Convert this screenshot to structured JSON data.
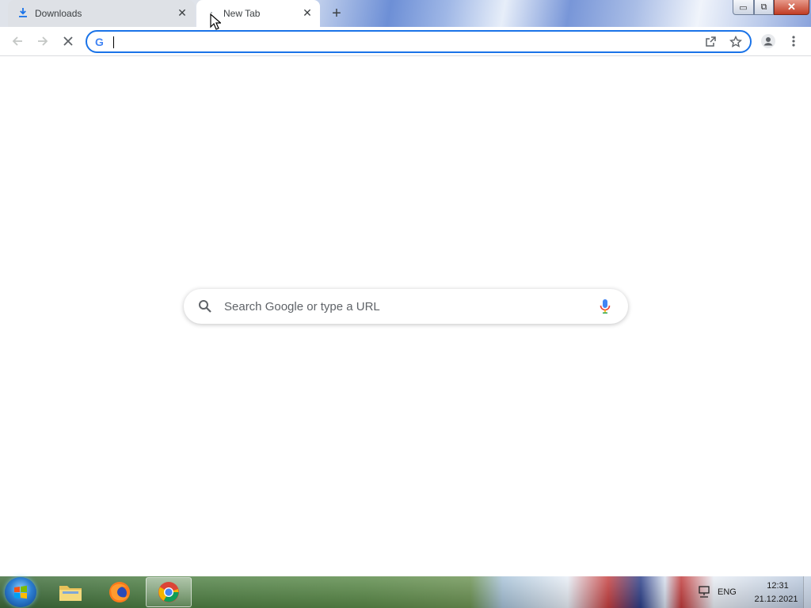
{
  "browser": {
    "tabs": [
      {
        "title": "Downloads",
        "icon": "download-icon",
        "active": false
      },
      {
        "title": "New Tab",
        "icon": "loading-icon",
        "active": true
      }
    ],
    "new_tab_symbol": "+",
    "close_symbol": "✕",
    "window_controls": {
      "minimize": "▭",
      "maximize": "⧉",
      "close": "✕"
    }
  },
  "toolbar": {
    "back_icon": "back-arrow-icon",
    "forward_icon": "forward-arrow-icon",
    "stop_icon": "stop-loading-icon",
    "omnibox": {
      "value": "",
      "google_glyph": "G"
    },
    "share_icon": "share-icon",
    "bookmark_icon": "star-icon",
    "profile_icon": "profile-icon",
    "menu_icon": "kebab-menu-icon"
  },
  "ntp": {
    "search_placeholder": "Search Google or type a URL",
    "search_icon": "search-icon",
    "mic_icon": "microphone-icon"
  },
  "taskbar": {
    "apps": [
      "file-explorer",
      "firefox",
      "chrome"
    ],
    "active_app": "chrome",
    "language": "ENG",
    "time": "12:31",
    "date": "21.12.2021"
  },
  "colors": {
    "accent": "#1a73e8",
    "tab_inactive": "#dee1e6",
    "text": "#3c4043",
    "icon": "#5f6368"
  }
}
